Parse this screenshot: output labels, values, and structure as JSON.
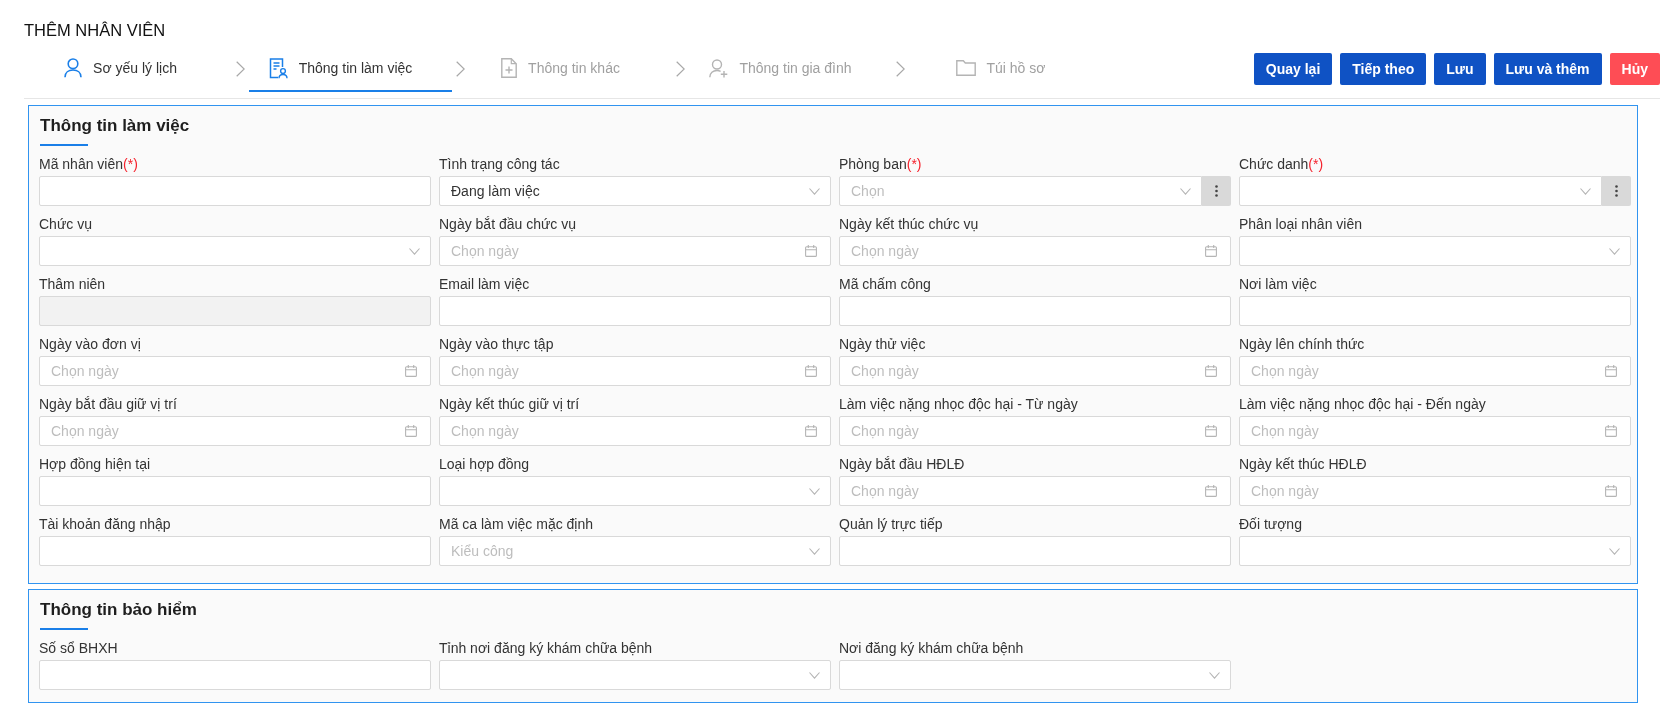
{
  "page": {
    "title": "THÊM NHÂN VIÊN"
  },
  "steps": [
    {
      "label": "Sơ yếu lý lịch",
      "selected": false,
      "disabled": false
    },
    {
      "label": "Thông tin làm việc",
      "selected": true,
      "disabled": false
    },
    {
      "label": "Thông tin khác",
      "selected": false,
      "disabled": true
    },
    {
      "label": "Thông tin gia đình",
      "selected": false,
      "disabled": true
    },
    {
      "label": "Túi hồ sơ",
      "selected": false,
      "disabled": true
    }
  ],
  "actions": [
    {
      "label": "Quay lại",
      "kind": "primary"
    },
    {
      "label": "Tiếp theo",
      "kind": "primary"
    },
    {
      "label": "Lưu",
      "kind": "primary"
    },
    {
      "label": "Lưu và thêm",
      "kind": "primary"
    },
    {
      "label": "Hủy",
      "kind": "danger"
    }
  ],
  "sections": [
    {
      "title": "Thông tin làm việc",
      "fields": [
        {
          "label": "Mã nhân viên",
          "required_mark": "(*)",
          "kind": "text"
        },
        {
          "label": "Tình trạng công tác",
          "kind": "select",
          "value": "Đang làm việc"
        },
        {
          "label": "Phòng ban",
          "required_mark": "(*)",
          "kind": "lookup",
          "placeholder": "Chọn"
        },
        {
          "label": "Chức danh",
          "required_mark": "(*)",
          "kind": "lookup"
        },
        {
          "label": "Chức vụ",
          "kind": "select"
        },
        {
          "label": "Ngày bắt đầu chức vụ",
          "kind": "date",
          "placeholder": "Chọn ngày"
        },
        {
          "label": "Ngày kết thúc chức vụ",
          "kind": "date",
          "placeholder": "Chọn ngày"
        },
        {
          "label": "Phân loại nhân viên",
          "kind": "select"
        },
        {
          "label": "Thâm niên",
          "kind": "readonly"
        },
        {
          "label": "Email làm việc",
          "kind": "text"
        },
        {
          "label": "Mã chấm công",
          "kind": "text"
        },
        {
          "label": "Nơi làm việc",
          "kind": "text"
        },
        {
          "label": "Ngày vào đơn vị",
          "kind": "date",
          "placeholder": "Chọn ngày"
        },
        {
          "label": "Ngày vào thực tập",
          "kind": "date",
          "placeholder": "Chọn ngày"
        },
        {
          "label": "Ngày thử việc",
          "kind": "date",
          "placeholder": "Chọn ngày"
        },
        {
          "label": "Ngày lên chính thức",
          "kind": "date",
          "placeholder": "Chọn ngày"
        },
        {
          "label": "Ngày bắt đầu giữ vị trí",
          "kind": "date",
          "placeholder": "Chọn ngày"
        },
        {
          "label": "Ngày kết thúc giữ vị trí",
          "kind": "date",
          "placeholder": "Chọn ngày"
        },
        {
          "label": "Làm việc nặng nhọc độc hại - Từ ngày",
          "kind": "date",
          "placeholder": "Chọn ngày"
        },
        {
          "label": "Làm việc nặng nhọc độc hại - Đến ngày",
          "kind": "date",
          "placeholder": "Chọn ngày"
        },
        {
          "label": "Hợp đồng hiện tại",
          "kind": "text"
        },
        {
          "label": "Loại hợp đồng",
          "kind": "select"
        },
        {
          "label": "Ngày bắt đầu HĐLĐ",
          "kind": "date",
          "placeholder": "Chọn ngày"
        },
        {
          "label": "Ngày kết thúc HĐLĐ",
          "kind": "date",
          "placeholder": "Chọn ngày"
        },
        {
          "label": "Tài khoản đăng nhập",
          "kind": "text"
        },
        {
          "label": "Mã ca làm việc mặc định",
          "kind": "select",
          "placeholder": "Kiểu công"
        },
        {
          "label": "Quản lý trực tiếp",
          "kind": "text"
        },
        {
          "label": "Đối tượng",
          "kind": "select"
        }
      ]
    },
    {
      "title": "Thông tin bảo hiểm",
      "fields": [
        {
          "label": "Số sổ BHXH",
          "kind": "text"
        },
        {
          "label": "Tỉnh nơi đăng ký khám chữa bệnh",
          "kind": "select"
        },
        {
          "label": "Nơi đăng ký khám chữa bệnh",
          "kind": "select"
        }
      ]
    }
  ]
}
